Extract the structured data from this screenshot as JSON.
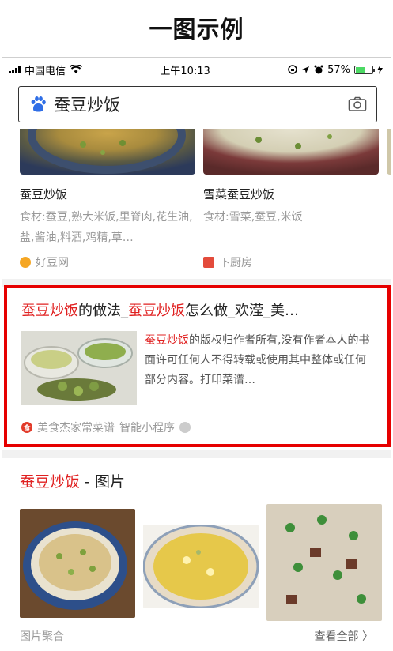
{
  "caption": "一图示例",
  "status_bar": {
    "carrier": "中国电信",
    "time": "上午10:13",
    "battery_pct": "57%"
  },
  "search": {
    "query": "蚕豆炒饭"
  },
  "recipes": [
    {
      "title": "蚕豆炒饭",
      "desc": "食材:蚕豆,熟大米饭,里脊肉,花生油,盐,酱油,料酒,鸡精,草…",
      "source": "好豆网"
    },
    {
      "title": "雪菜蚕豆炒饭",
      "desc": "食材:雪菜,蚕豆,米饭",
      "source": "下厨房"
    }
  ],
  "result": {
    "title_hl_1": "蚕豆炒饭",
    "title_mid": "的做法_",
    "title_hl_2": "蚕豆炒饭",
    "title_tail": "怎么做_欢滢_美…",
    "body_hl": "蚕豆炒饭",
    "body": "的版权归作者所有,没有作者本人的书面许可任何人不得转载或使用其中整体或任何部分内容。打印菜谱…",
    "source": "美食杰家常菜谱",
    "tag": "智能小程序"
  },
  "images_section": {
    "title_hl": "蚕豆炒饭",
    "title_tail": " - 图片"
  },
  "footer": {
    "left": "图片聚合",
    "right": "查看全部 〉"
  },
  "colors": {
    "highlight": "#e02020",
    "result_border": "#e60000",
    "battery": "#4cd964"
  },
  "icons": [
    "signal-icon",
    "wifi-icon",
    "lock-rotation-icon",
    "location-icon",
    "alarm-icon",
    "battery-icon",
    "charging-icon",
    "baidu-paw-icon",
    "camera-icon"
  ]
}
